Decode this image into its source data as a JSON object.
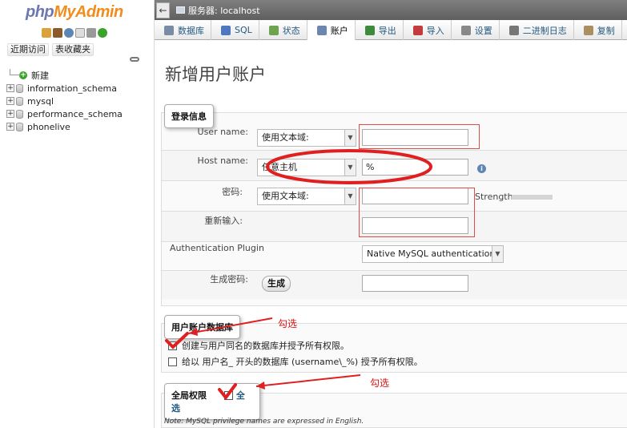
{
  "nav": {
    "logo_php": "php",
    "logo_myadmin": "MyAdmin",
    "tabs": [
      "近期访问",
      "表收藏夹"
    ],
    "tree": [
      {
        "label": "新建",
        "type": "new"
      },
      {
        "label": "information_schema",
        "type": "db"
      },
      {
        "label": "mysql",
        "type": "db"
      },
      {
        "label": "performance_schema",
        "type": "db"
      },
      {
        "label": "phonelive",
        "type": "db"
      }
    ]
  },
  "serverbar": {
    "label": "服务器: localhost"
  },
  "menu": {
    "tabs": [
      {
        "label": "数据库",
        "icon": "database-icon",
        "color": "#7a8ba6"
      },
      {
        "label": "SQL",
        "icon": "sql-icon",
        "color": "#4d78c0"
      },
      {
        "label": "状态",
        "icon": "status-icon",
        "color": "#6fa352"
      },
      {
        "label": "账户",
        "icon": "accounts-icon",
        "color": "#6d86b0",
        "active": true
      },
      {
        "label": "导出",
        "icon": "export-icon",
        "color": "#3d8a3d"
      },
      {
        "label": "导入",
        "icon": "import-icon",
        "color": "#c23c3c"
      },
      {
        "label": "设置",
        "icon": "wrench-icon",
        "color": "#888888"
      },
      {
        "label": "二进制日志",
        "icon": "binlog-icon",
        "color": "#777777"
      },
      {
        "label": "复制",
        "icon": "replication-icon",
        "color": "#aa9060"
      }
    ]
  },
  "main": {
    "title": "新增用户账户",
    "login": {
      "legend": "登录信息",
      "username_label": "User name:",
      "username_select": "使用文本域:",
      "username_value": "",
      "host_label": "Host name:",
      "host_select": "任意主机",
      "host_value": "%",
      "password_label": "密码:",
      "password_select": "使用文本域:",
      "strength_label": "Strength:",
      "retype_label": "重新输入:",
      "auth_label": "Authentication Plugin",
      "auth_select": "Native MySQL authentication",
      "generate_label": "生成密码:",
      "generate_button": "生成"
    },
    "database": {
      "legend": "用户账户数据库",
      "opt1": "创建与用户同名的数据库并授予所有权限。",
      "opt2": "给以 用户名_ 开头的数据库 (username\\_%) 授予所有权限。"
    },
    "global": {
      "legend": "全局权限",
      "select_all": "全选",
      "note": "Note: MySQL privilege names are expressed in English."
    }
  },
  "annotations": {
    "check_text_1": "勾选",
    "check_text_2": "勾选",
    "color": "#e02020"
  }
}
